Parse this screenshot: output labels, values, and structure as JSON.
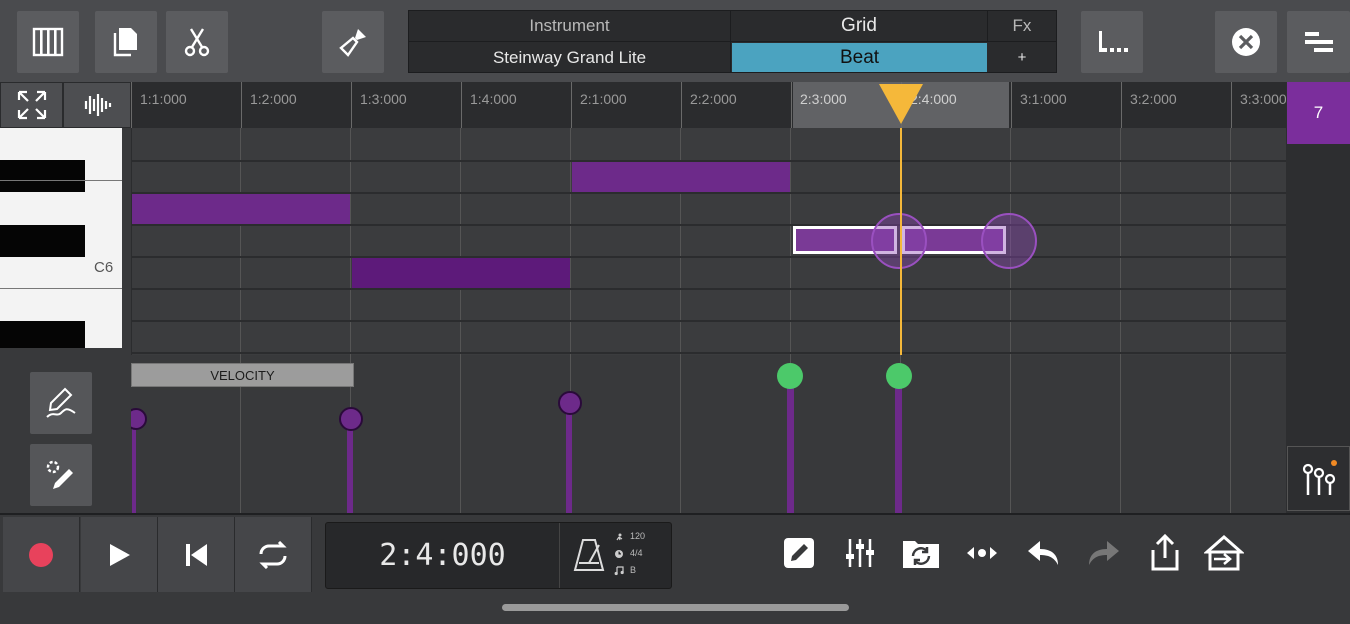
{
  "toolbar": {
    "instrument_header": "Instrument",
    "instrument_value": "Steinway Grand Lite",
    "grid_header": "Grid",
    "grid_value": "Beat",
    "fx_header": "Fx",
    "fx_value": "+"
  },
  "ruler": {
    "labels": [
      "1:1:000",
      "1:2:000",
      "1:3:000",
      "1:4:000",
      "2:1:000",
      "2:2:000",
      "2:3:000",
      "2:4:000",
      "3:1:000",
      "3:2:000",
      "3:3:000"
    ]
  },
  "piano": {
    "c6_label": "C6"
  },
  "velocity": {
    "label": "VELOCITY"
  },
  "right_panel": {
    "track_number": "7"
  },
  "transport": {
    "position": "2:4:000",
    "tempo": "120",
    "time_signature": "4/4",
    "key": "B"
  },
  "colors": {
    "note_purple": "#6d2a8a",
    "selected_note": "#7a3a96",
    "playhead": "#f5b83a",
    "beat_highlight": "#4ba3c0",
    "velocity_active": "#4cc96a",
    "record": "#e8425c",
    "track_tab": "#7b2e9c"
  },
  "icons": {
    "top_left": [
      "piano-keys-icon",
      "copy-icon",
      "scissors-icon"
    ],
    "brush": "brush-icon",
    "quantize": "quantize-icon",
    "close": "close-circle-icon",
    "menu": "menu-align-icon",
    "expand": "expand-icon",
    "waveform": "waveform-icon",
    "draw_velocity": "draw-curve-icon",
    "pen_settings": "pen-settings-icon",
    "mixer": "mixer-knobs-icon",
    "bottom_controls": [
      "pencil-icon",
      "mixer-sliders-icon",
      "folder-sync-icon",
      "move-horizontal-icon",
      "undo-icon",
      "redo-icon",
      "share-icon",
      "export-icon"
    ],
    "transport": [
      "record-icon",
      "play-icon",
      "skip-start-icon",
      "loop-icon"
    ],
    "metronome": "metronome-icon"
  }
}
